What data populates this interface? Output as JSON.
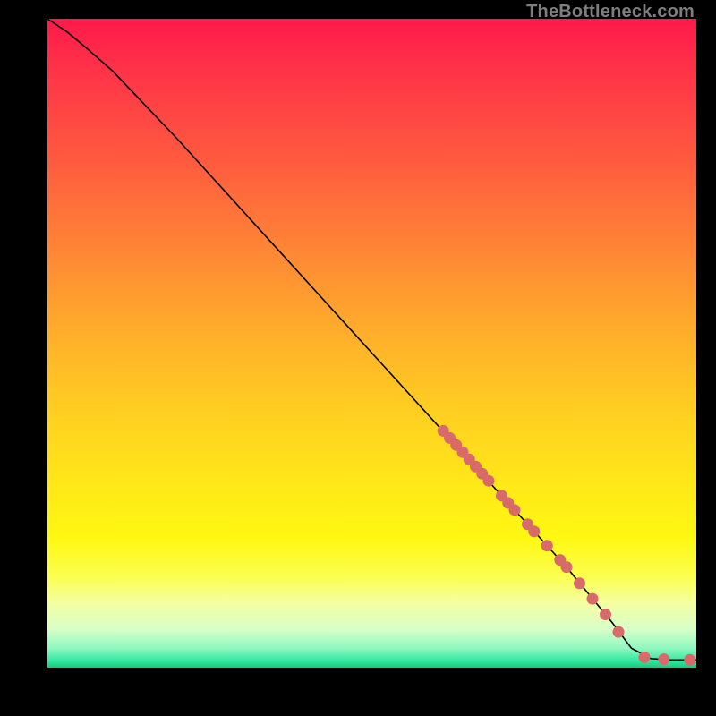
{
  "watermark": "TheBottleneck.com",
  "colors": {
    "background": "#000000",
    "curve_stroke": "#000000",
    "marker_fill": "#d96a6a",
    "marker_stroke": "#b25050"
  },
  "chart_data": {
    "type": "line",
    "title": "",
    "xlabel": "",
    "ylabel": "",
    "xlim": [
      0,
      100
    ],
    "ylim": [
      0,
      100
    ],
    "grid": false,
    "series": [
      {
        "name": "curve",
        "x": [
          0,
          3,
          6,
          10,
          20,
          30,
          40,
          50,
          60,
          70,
          80,
          87,
          90,
          93,
          96,
          100
        ],
        "y": [
          100,
          98,
          95.5,
          92,
          81.5,
          70.5,
          59.5,
          48.5,
          37.5,
          26.5,
          15.5,
          7,
          3,
          1.4,
          1.2,
          1.2
        ]
      }
    ],
    "markers": [
      {
        "x": 61,
        "y": 36.5
      },
      {
        "x": 62,
        "y": 35.4
      },
      {
        "x": 63,
        "y": 34.3
      },
      {
        "x": 64,
        "y": 33.2
      },
      {
        "x": 65,
        "y": 32.1
      },
      {
        "x": 66,
        "y": 31.0
      },
      {
        "x": 67,
        "y": 29.9
      },
      {
        "x": 68,
        "y": 28.8
      },
      {
        "x": 70,
        "y": 26.5
      },
      {
        "x": 71,
        "y": 25.4
      },
      {
        "x": 72,
        "y": 24.3
      },
      {
        "x": 74,
        "y": 22.1
      },
      {
        "x": 75,
        "y": 21.0
      },
      {
        "x": 77,
        "y": 18.8
      },
      {
        "x": 79,
        "y": 16.6
      },
      {
        "x": 80,
        "y": 15.5
      },
      {
        "x": 82,
        "y": 13.0
      },
      {
        "x": 84,
        "y": 10.6
      },
      {
        "x": 86,
        "y": 8.2
      },
      {
        "x": 88,
        "y": 5.5
      },
      {
        "x": 92,
        "y": 1.6
      },
      {
        "x": 95,
        "y": 1.3
      },
      {
        "x": 99,
        "y": 1.2
      }
    ]
  }
}
